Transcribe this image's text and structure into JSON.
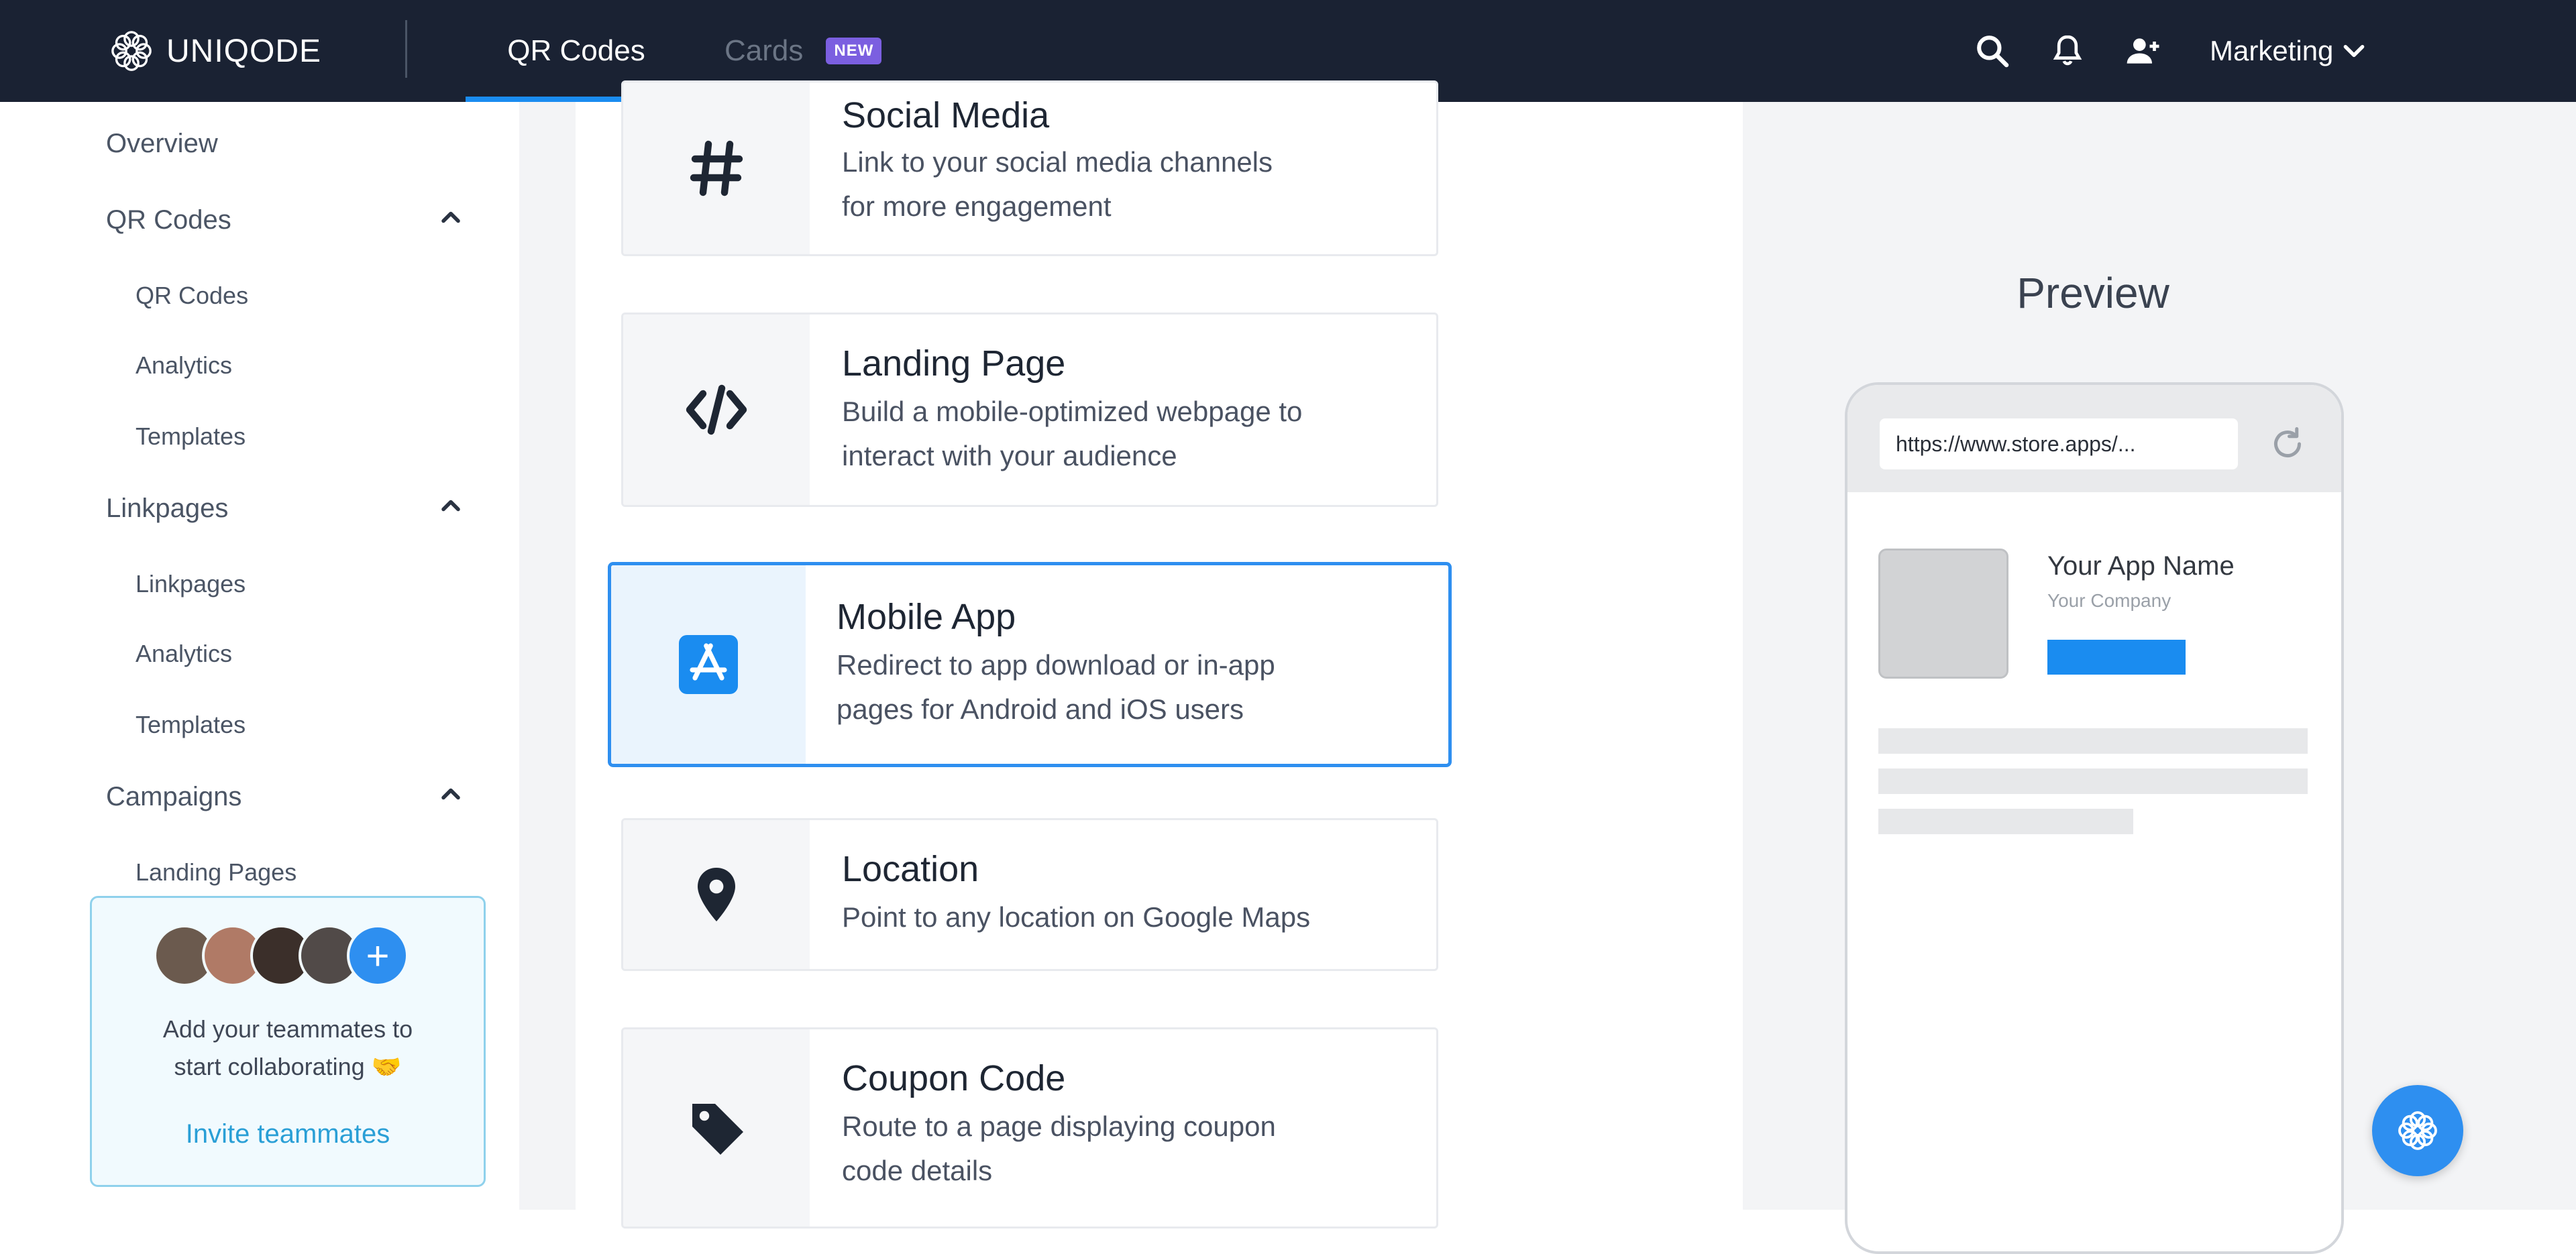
{
  "app": {
    "brand": "UNIQODE"
  },
  "nav": {
    "tabs": [
      {
        "label": "QR Codes",
        "active": true
      },
      {
        "label": "Cards",
        "badge": "NEW"
      }
    ],
    "account_label": "Marketing",
    "icons": [
      "search-icon",
      "bell-icon",
      "add-user-icon",
      "chevron-down-icon"
    ]
  },
  "sidebar": {
    "overview": "Overview",
    "sections": [
      {
        "label": "QR Codes",
        "items": [
          "QR Codes",
          "Analytics",
          "Templates"
        ]
      },
      {
        "label": "Linkpages",
        "items": [
          "Linkpages",
          "Analytics",
          "Templates"
        ]
      },
      {
        "label": "Campaigns",
        "items": [
          "Landing Pages"
        ]
      }
    ],
    "invite": {
      "text_line1": "Add your teammates to",
      "text_line2": "start collaborating 🤝",
      "link": "Invite teammates"
    }
  },
  "qr_types": [
    {
      "title": "Social Media",
      "desc1": "Link to your social media channels",
      "desc2": "for more engagement",
      "icon": "hash-icon"
    },
    {
      "title": "Landing Page",
      "desc1": "Build a mobile-optimized webpage to",
      "desc2": "interact with your audience",
      "icon": "code-icon"
    },
    {
      "title": "Mobile App",
      "desc1": "Redirect to app download or in-app",
      "desc2": "pages for Android and iOS users",
      "icon": "app-store-icon",
      "selected": true
    },
    {
      "title": "Location",
      "desc1": "Point to any location on Google Maps",
      "desc2": "",
      "icon": "location-pin-icon"
    },
    {
      "title": "Coupon Code",
      "desc1": "Route to a page displaying coupon",
      "desc2": "code details",
      "icon": "tag-icon"
    }
  ],
  "preview": {
    "title": "Preview",
    "url": "https://www.store.apps/...",
    "app_name": "Your App Name",
    "company": "Your Company"
  },
  "colors": {
    "accent": "#2e8ff0",
    "topbar": "#1a2233",
    "badge": "#7b5fe0"
  }
}
